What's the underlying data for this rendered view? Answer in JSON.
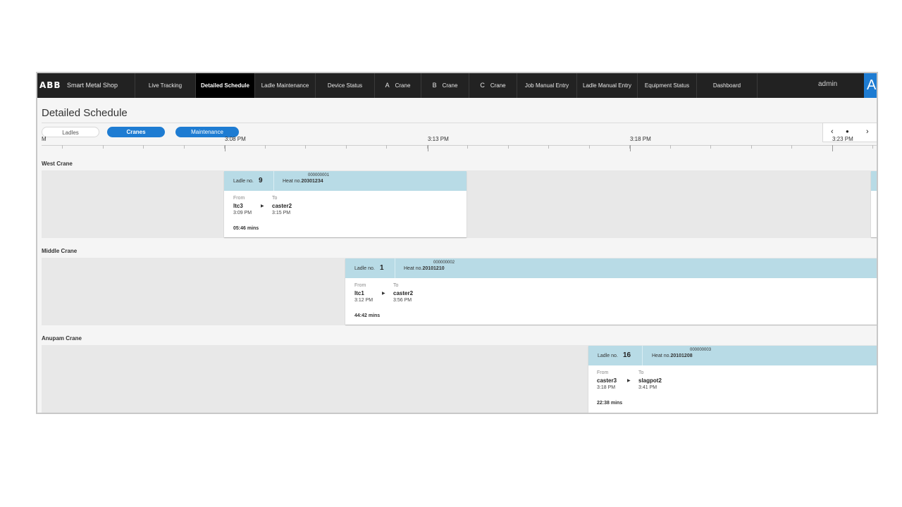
{
  "nav": {
    "logo": "ABB",
    "app_name": "Smart Metal Shop",
    "items": [
      {
        "label": "Live Tracking"
      },
      {
        "label": "Detailed Schedule",
        "active": true
      },
      {
        "label": "Ladle Maintenance"
      },
      {
        "label": "Device Status"
      },
      {
        "letter": "A",
        "label": "Crane"
      },
      {
        "letter": "B",
        "label": "Crane"
      },
      {
        "letter": "C",
        "label": "Crane"
      },
      {
        "label": "Job Manual Entry"
      },
      {
        "label": "Ladle Manual Entry"
      },
      {
        "label": "Equipment Status"
      },
      {
        "label": "Dashboard"
      }
    ],
    "user": "admin",
    "corner_glyph": "A"
  },
  "page": {
    "title": "Detailed Schedule",
    "filters": [
      "Ladles",
      "Cranes",
      "Maintenance"
    ],
    "active_filters": [
      "Cranes",
      "Maintenance"
    ],
    "pager": {
      "prev": "‹",
      "dot": "●",
      "next": "›"
    }
  },
  "timeline": {
    "tick_labels": [
      "M",
      "3:08 PM",
      "3:13 PM",
      "3:18 PM",
      "3:23 PM"
    ]
  },
  "lanes": [
    {
      "name": "West Crane",
      "job": {
        "ladle_label": "Ladle no.",
        "ladle_no": "9",
        "heat_label": "Heat no.",
        "heat_no": "20301234",
        "heat_top": "000000001",
        "from_label": "From",
        "from": "ltc3",
        "from_time": "3:09 PM",
        "to_label": "To",
        "to": "caster2",
        "to_time": "3:15 PM",
        "duration": "05:46 mins"
      }
    },
    {
      "name": "Middle Crane",
      "job": {
        "ladle_label": "Ladle no.",
        "ladle_no": "1",
        "heat_label": "Heat no.",
        "heat_no": "20101210",
        "heat_top": "000000002",
        "from_label": "From",
        "from": "ltc1",
        "from_time": "3:12 PM",
        "to_label": "To",
        "to": "caster2",
        "to_time": "3:56 PM",
        "duration": "44:42 mins"
      }
    },
    {
      "name": "Anupam Crane",
      "job": {
        "ladle_label": "Ladle no.",
        "ladle_no": "16",
        "heat_label": "Heat no.",
        "heat_no": "20101208",
        "heat_top": "000000003",
        "from_label": "From",
        "from": "caster3",
        "from_time": "3:18 PM",
        "to_label": "To",
        "to": "slagpot2",
        "to_time": "3:41 PM",
        "duration": "22:38 mins"
      }
    }
  ],
  "colors": {
    "nav_bg": "#222222",
    "accent": "#1e7cd2",
    "job_header": "#b8dbe6",
    "lane_bg": "#e8e8e8"
  }
}
